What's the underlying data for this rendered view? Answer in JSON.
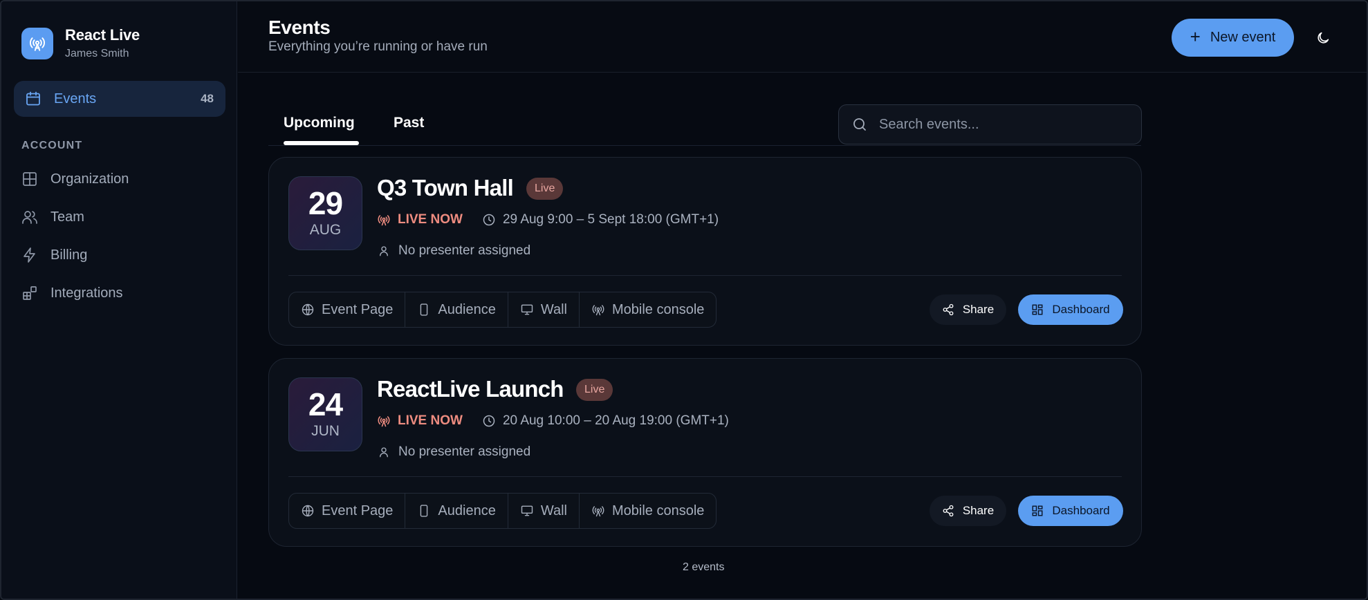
{
  "brand": {
    "name": "React Live",
    "user": "James Smith"
  },
  "sidebar": {
    "active": {
      "label": "Events",
      "count": "48"
    },
    "section_title": "ACCOUNT",
    "items": [
      {
        "label": "Organization",
        "icon": "layout-grid-icon"
      },
      {
        "label": "Team",
        "icon": "users-icon"
      },
      {
        "label": "Billing",
        "icon": "lightning-icon"
      },
      {
        "label": "Integrations",
        "icon": "blocks-icon"
      }
    ]
  },
  "header": {
    "title": "Events",
    "subtitle": "Everything you’re running or have run",
    "new_button": "New event"
  },
  "tabs": {
    "upcoming": "Upcoming",
    "past": "Past",
    "active": "Upcoming"
  },
  "search": {
    "placeholder": "Search events...",
    "value": ""
  },
  "events": [
    {
      "day": "29",
      "month": "AUG",
      "title": "Q3 Town Hall",
      "badge": "Live",
      "live_label": "LIVE NOW",
      "time": "29 Aug 9:00 – 5 Sept 18:00 (GMT+1)",
      "presenter": "No presenter assigned",
      "links": {
        "event_page": "Event Page",
        "audience": "Audience",
        "wall": "Wall",
        "mobile": "Mobile console"
      },
      "share": "Share",
      "dashboard": "Dashboard"
    },
    {
      "day": "24",
      "month": "JUN",
      "title": "ReactLive Launch",
      "badge": "Live",
      "live_label": "LIVE NOW",
      "time": "20 Aug 10:00 – 20 Aug 19:00 (GMT+1)",
      "presenter": "No presenter assigned",
      "links": {
        "event_page": "Event Page",
        "audience": "Audience",
        "wall": "Wall",
        "mobile": "Mobile console"
      },
      "share": "Share",
      "dashboard": "Dashboard"
    }
  ],
  "footer": {
    "count": "2 events"
  },
  "colors": {
    "accent": "#5b9df1",
    "live": "#ee8c80",
    "badge_bg": "#5a3838",
    "background": "#060a12"
  }
}
